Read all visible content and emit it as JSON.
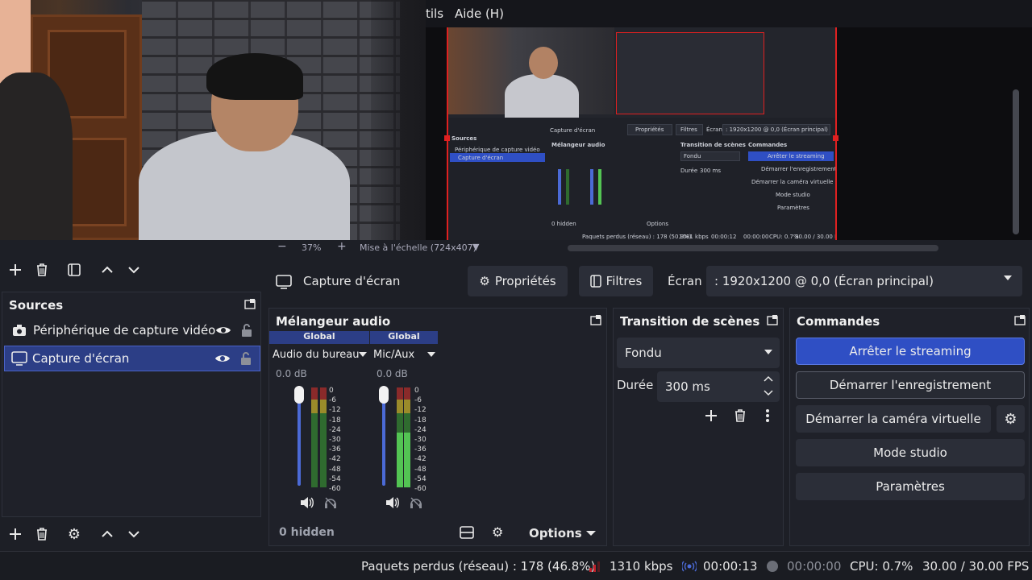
{
  "menu": {
    "tools_partial": "tils",
    "help": "Aide (H)"
  },
  "zoom": {
    "percent": "37%",
    "scale_label": "Mise à l'échelle (724x407)"
  },
  "source_toolbar": {
    "source_name": "Capture d'écran",
    "properties": "Propriétés",
    "filters": "Filtres",
    "screen_label": "Écran",
    "screen_value": ": 1920x1200 @ 0,0 (Écran principal)"
  },
  "sources": {
    "title": "Sources",
    "items": [
      {
        "label": "Périphérique de capture vidéo",
        "selected": false
      },
      {
        "label": "Capture d'écran",
        "selected": true
      }
    ]
  },
  "mixer": {
    "title": "Mélangeur audio",
    "channels": [
      {
        "header": "Global",
        "name": "Audio du bureau",
        "db": "0.0 dB"
      },
      {
        "header": "Global",
        "name": "Mic/Aux",
        "db": "0.0 dB"
      }
    ],
    "scale": [
      "0",
      "-6",
      "-12",
      "-18",
      "-24",
      "-30",
      "-36",
      "-42",
      "-48",
      "-54",
      "-60"
    ],
    "hidden": "0 hidden",
    "options": "Options"
  },
  "transition": {
    "title": "Transition de scènes",
    "type": "Fondu",
    "duration_label": "Durée",
    "duration_value": "300 ms"
  },
  "controls": {
    "title": "Commandes",
    "stop_streaming": "Arrêter le streaming",
    "start_recording": "Démarrer l'enregistrement",
    "start_virtual_cam": "Démarrer la caméra virtuelle",
    "studio_mode": "Mode studio",
    "settings": "Paramètres"
  },
  "status": {
    "dropped": "Paquets perdus (réseau) : 178 (46.8%)",
    "bitrate": "1310 kbps",
    "stream_time": "00:00:13",
    "rec_time": "00:00:00",
    "cpu": "CPU: 0.7%",
    "fps": "30.00 / 30.00 FPS"
  },
  "preview_mini": {
    "sources": "Sources",
    "src1": "Périphérique de capture vidéo",
    "src2": "Capture d'écran",
    "capture": "Capture d'écran",
    "props": "Propriétés",
    "filters": "Filtres",
    "screen": "Écran",
    "screen_value": ": 1920x1200 @ 0,0 (Écran principal)",
    "mixer": "Mélangeur audio",
    "transition": "Transition de scènes",
    "commands": "Commandes",
    "fade": "Fondu",
    "duration": "Durée",
    "duration_value": "300 ms",
    "stop_stream": "Arrêter le streaming",
    "start_rec": "Démarrer l'enregistrement",
    "virtual_cam": "Démarrer la caméra virtuelle",
    "studio": "Mode studio",
    "settings": "Paramètres",
    "hidden": "0 hidden",
    "options": "Options",
    "status": "Paquets perdus (réseau) : 178 (50.9%)",
    "kbps": "1081 kbps",
    "time": "00:00:12",
    "rec": "00:00:00",
    "cpu": "CPU: 0.7%",
    "fps": "30.00 / 30.00 FPS"
  },
  "colors": {
    "accent": "#2f4fc4",
    "selected": "#2c3e86",
    "background": "#1d1f26"
  }
}
